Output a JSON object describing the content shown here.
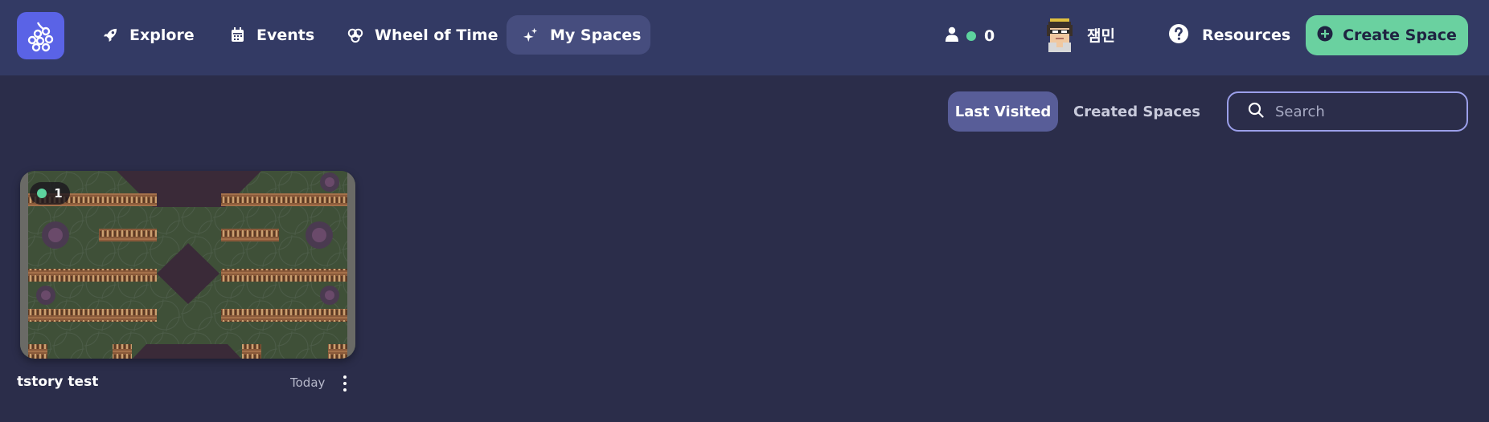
{
  "header": {
    "logo_icon": "grapes-logo-icon",
    "nav": [
      {
        "label": "Explore",
        "icon": "rocket-icon"
      },
      {
        "label": "Events",
        "icon": "calendar-icon"
      },
      {
        "label": "Wheel of Time",
        "icon": "wheel-of-time-icon"
      },
      {
        "label": "My Spaces",
        "icon": "sparkles-icon",
        "active": true
      }
    ],
    "online_count": "0",
    "user_name": "잼민",
    "resources_label": "Resources",
    "create_label": "Create Space"
  },
  "filters": {
    "tabs": [
      {
        "label": "Last Visited",
        "active": true
      },
      {
        "label": "Created Spaces",
        "active": false
      }
    ],
    "search_placeholder": "Search"
  },
  "spaces": [
    {
      "name": "tstory test",
      "date": "Today",
      "online": "1"
    }
  ],
  "colors": {
    "topbar": "#333a64",
    "background": "#2b2d4a",
    "accent_green": "#6ad1a0",
    "active_tab": "#585d98",
    "logo": "#5a63e6"
  }
}
